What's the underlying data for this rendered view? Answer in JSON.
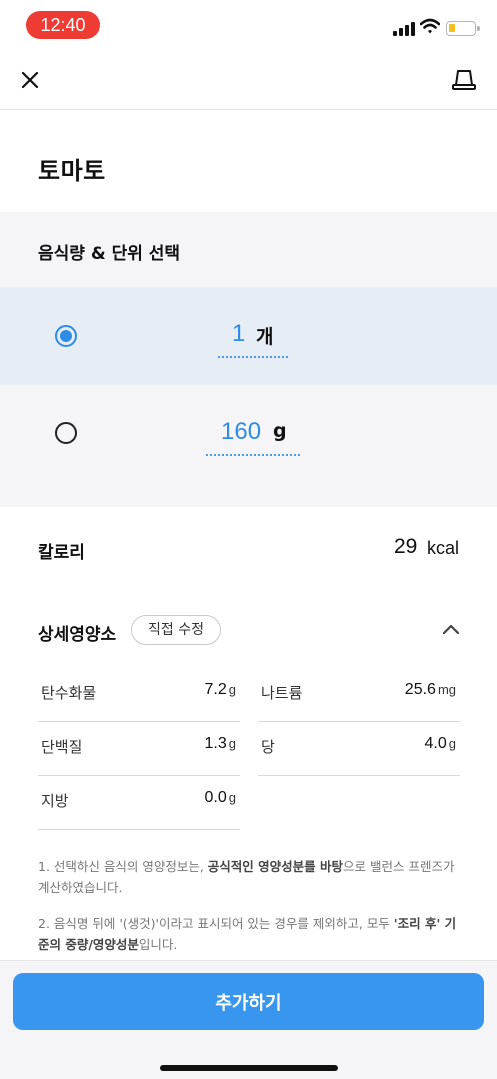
{
  "status_bar": {
    "time": "12:40"
  },
  "nav": {
    "close_icon": "close-icon",
    "scale_icon": "scale-icon"
  },
  "title": "토마토",
  "unit_section": {
    "header": "음식량 & 단위 선택",
    "options": [
      {
        "amount": "1",
        "unit": "개",
        "selected": true
      },
      {
        "amount": "160",
        "unit": "g",
        "selected": false
      }
    ]
  },
  "calories": {
    "label": "칼로리",
    "value": "29",
    "unit": "kcal"
  },
  "detail": {
    "title": "상세영양소",
    "edit_label": "직접 수정",
    "nutrients": [
      {
        "name": "탄수화물",
        "value": "7.2",
        "unit": "g"
      },
      {
        "name": "나트륨",
        "value": "25.6",
        "unit": "mg"
      },
      {
        "name": "단백질",
        "value": "1.3",
        "unit": "g"
      },
      {
        "name": "당",
        "value": "4.0",
        "unit": "g"
      },
      {
        "name": "지방",
        "value": "0.0",
        "unit": "g"
      }
    ]
  },
  "notes": {
    "note1_a": "1. 선택하신 음식의 영양정보는, ",
    "note1_b": "공식적인 영양성분를 바탕",
    "note1_c": "으로 밸런스 프렌즈가 계산하였습니다.",
    "note2_a": "2. 음식명 뒤에 '(생것)'이라고 표시되어 있는 경우를 제외하고, 모두 ",
    "note2_b": "'조리 후' 기준의 중량/영양성분",
    "note2_c": "입니다."
  },
  "actions": {
    "add_label": "추가하기"
  },
  "colors": {
    "accent": "#3896ee",
    "time_pill": "#ee3b33",
    "selected_row": "#e6edf4"
  }
}
